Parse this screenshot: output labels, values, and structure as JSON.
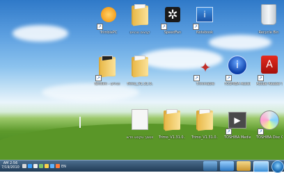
{
  "desktop": {
    "icons": [
      {
        "name": "trimble-icon",
        "label": "TrimblePC",
        "shortcut": true
      },
      {
        "name": "folder-icon",
        "label": "קבצים טכניים",
        "shortcut": false
      },
      {
        "name": "speedfan-icon",
        "label": "SpeedFan",
        "shortcut": true
      },
      {
        "name": "notepad-icon",
        "label": "Notebook",
        "shortcut": true
      },
      {
        "name": "recycle-bin-icon",
        "label": "Recycle Bin",
        "shortcut": false
      },
      {
        "name": "folder-icon",
        "label": "Tehillim - ספר תהלים",
        "shortcut": true
      },
      {
        "name": "folder-zip-icon",
        "label": "Trimo_V1.31.0...",
        "shortcut": false
      },
      {
        "name": "compass-icon",
        "label": "Trimmable",
        "shortcut": true
      },
      {
        "name": "toshiba-assist-icon",
        "label": "TOSHIBA Assist",
        "shortcut": true
      },
      {
        "name": "adobe-reader-icon",
        "label": "Adobe Reader 9",
        "shortcut": true
      },
      {
        "name": "document-icon",
        "label": "מסמך טקסט חדש",
        "shortcut": false
      },
      {
        "name": "folder-icon",
        "label": "Trimo_V1.31.0...",
        "shortcut": false
      },
      {
        "name": "folder-icon",
        "label": "Trimo_V1.31.0...",
        "shortcut": false
      },
      {
        "name": "media-player-icon",
        "label": "TOSHIBA Media Controller",
        "shortcut": true
      },
      {
        "name": "disc-creator-icon",
        "label": "TOSHIBA Disc Creator",
        "shortcut": true
      }
    ]
  },
  "taskbar": {
    "time": "AM 2:56",
    "date": "7/19/2010",
    "language": "EN",
    "colors": {
      "bar": "#1f3a55",
      "accent": "#4c6e8e"
    }
  }
}
